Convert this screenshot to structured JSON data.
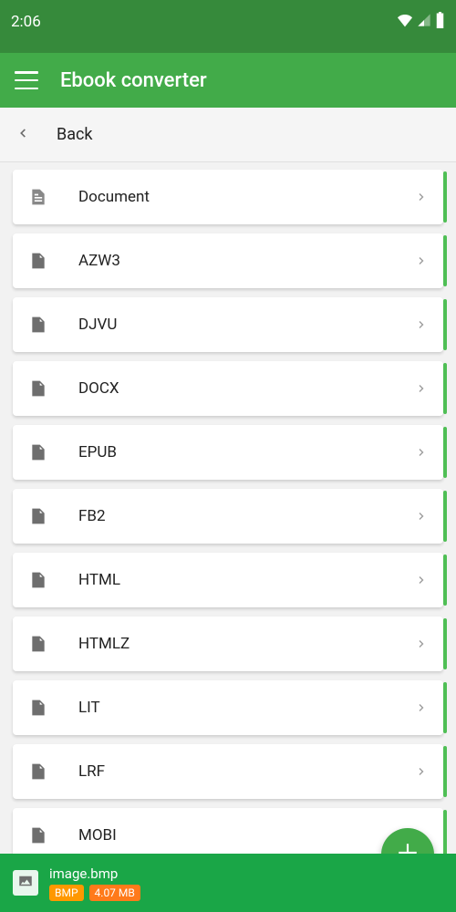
{
  "status": {
    "time": "2:06"
  },
  "header": {
    "title": "Ebook converter"
  },
  "nav": {
    "back_label": "Back"
  },
  "formats": [
    {
      "label": "Document",
      "doc_style": true
    },
    {
      "label": "AZW3"
    },
    {
      "label": "DJVU"
    },
    {
      "label": "DOCX"
    },
    {
      "label": "EPUB"
    },
    {
      "label": "FB2"
    },
    {
      "label": "HTML"
    },
    {
      "label": "HTMLZ"
    },
    {
      "label": "LIT"
    },
    {
      "label": "LRF"
    },
    {
      "label": "MOBI"
    }
  ],
  "bottom": {
    "filename": "image.bmp",
    "ext_chip": "BMP",
    "size_chip": "4.07 MB"
  }
}
